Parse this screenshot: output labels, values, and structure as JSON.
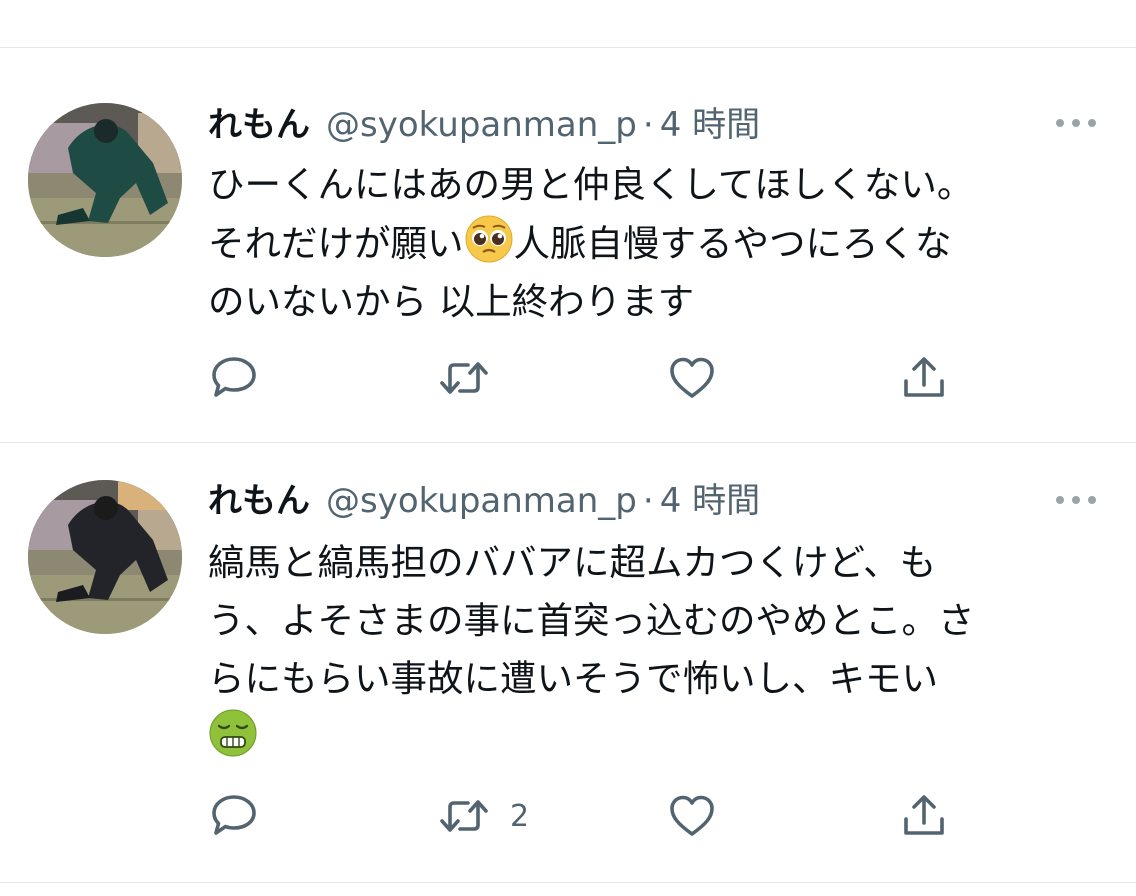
{
  "tweets": [
    {
      "display_name": "れもん",
      "handle": "@syokupanman_p",
      "separator": "·",
      "time": "4 時間",
      "lines": [
        "ひーくんにはあの男と仲良くしてほしくない。",
        "それだけが願い",
        "人脈自慢するやつにろくな",
        "のいないから 以上終わります"
      ],
      "inline_emoji": "pleading-face",
      "actions": {
        "reply": "reply-icon",
        "retweet": "retweet-icon",
        "retweet_count": "",
        "like": "heart-icon",
        "share": "share-icon"
      }
    },
    {
      "display_name": "れもん",
      "handle": "@syokupanman_p",
      "separator": "·",
      "time": "4 時間",
      "lines": [
        "縞馬と縞馬担のババアに超ムカつくけど、も",
        "う、よそさまの事に首突っ込むのやめとこ。さ",
        "らにもらい事故に遭いそうで怖いし、キモい"
      ],
      "trailing_emoji": "nauseated-face",
      "actions": {
        "reply": "reply-icon",
        "retweet": "retweet-icon",
        "retweet_count": "2",
        "like": "heart-icon",
        "share": "share-icon"
      }
    }
  ],
  "colors": {
    "text": "#0f1419",
    "secondary": "#536471",
    "divider": "#e4e7ea"
  }
}
